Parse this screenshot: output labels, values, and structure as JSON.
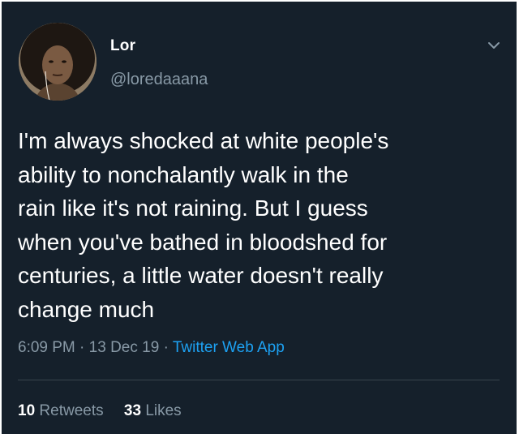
{
  "tweet": {
    "author": {
      "display_name": "Lor",
      "handle": "@loredaaana"
    },
    "text": "I'm always shocked at white people's\nability to nonchalantly walk in the\nrain like it's not raining. But I guess\nwhen you've bathed in bloodshed for\ncenturies, a little water doesn't really\nchange much",
    "time": "6:09 PM",
    "date": "13 Dec 19",
    "source": "Twitter Web App",
    "separator": "·",
    "stats": {
      "retweets_count": "10",
      "retweets_label": "Retweets",
      "likes_count": "33",
      "likes_label": "Likes"
    }
  },
  "icons": {
    "menu": "chevron-down-icon",
    "avatar": "avatar"
  },
  "colors": {
    "background": "#15202b",
    "primary_text": "#ffffff",
    "secondary_text": "#8899a6",
    "link": "#1da1f2",
    "divider": "#38444d"
  }
}
